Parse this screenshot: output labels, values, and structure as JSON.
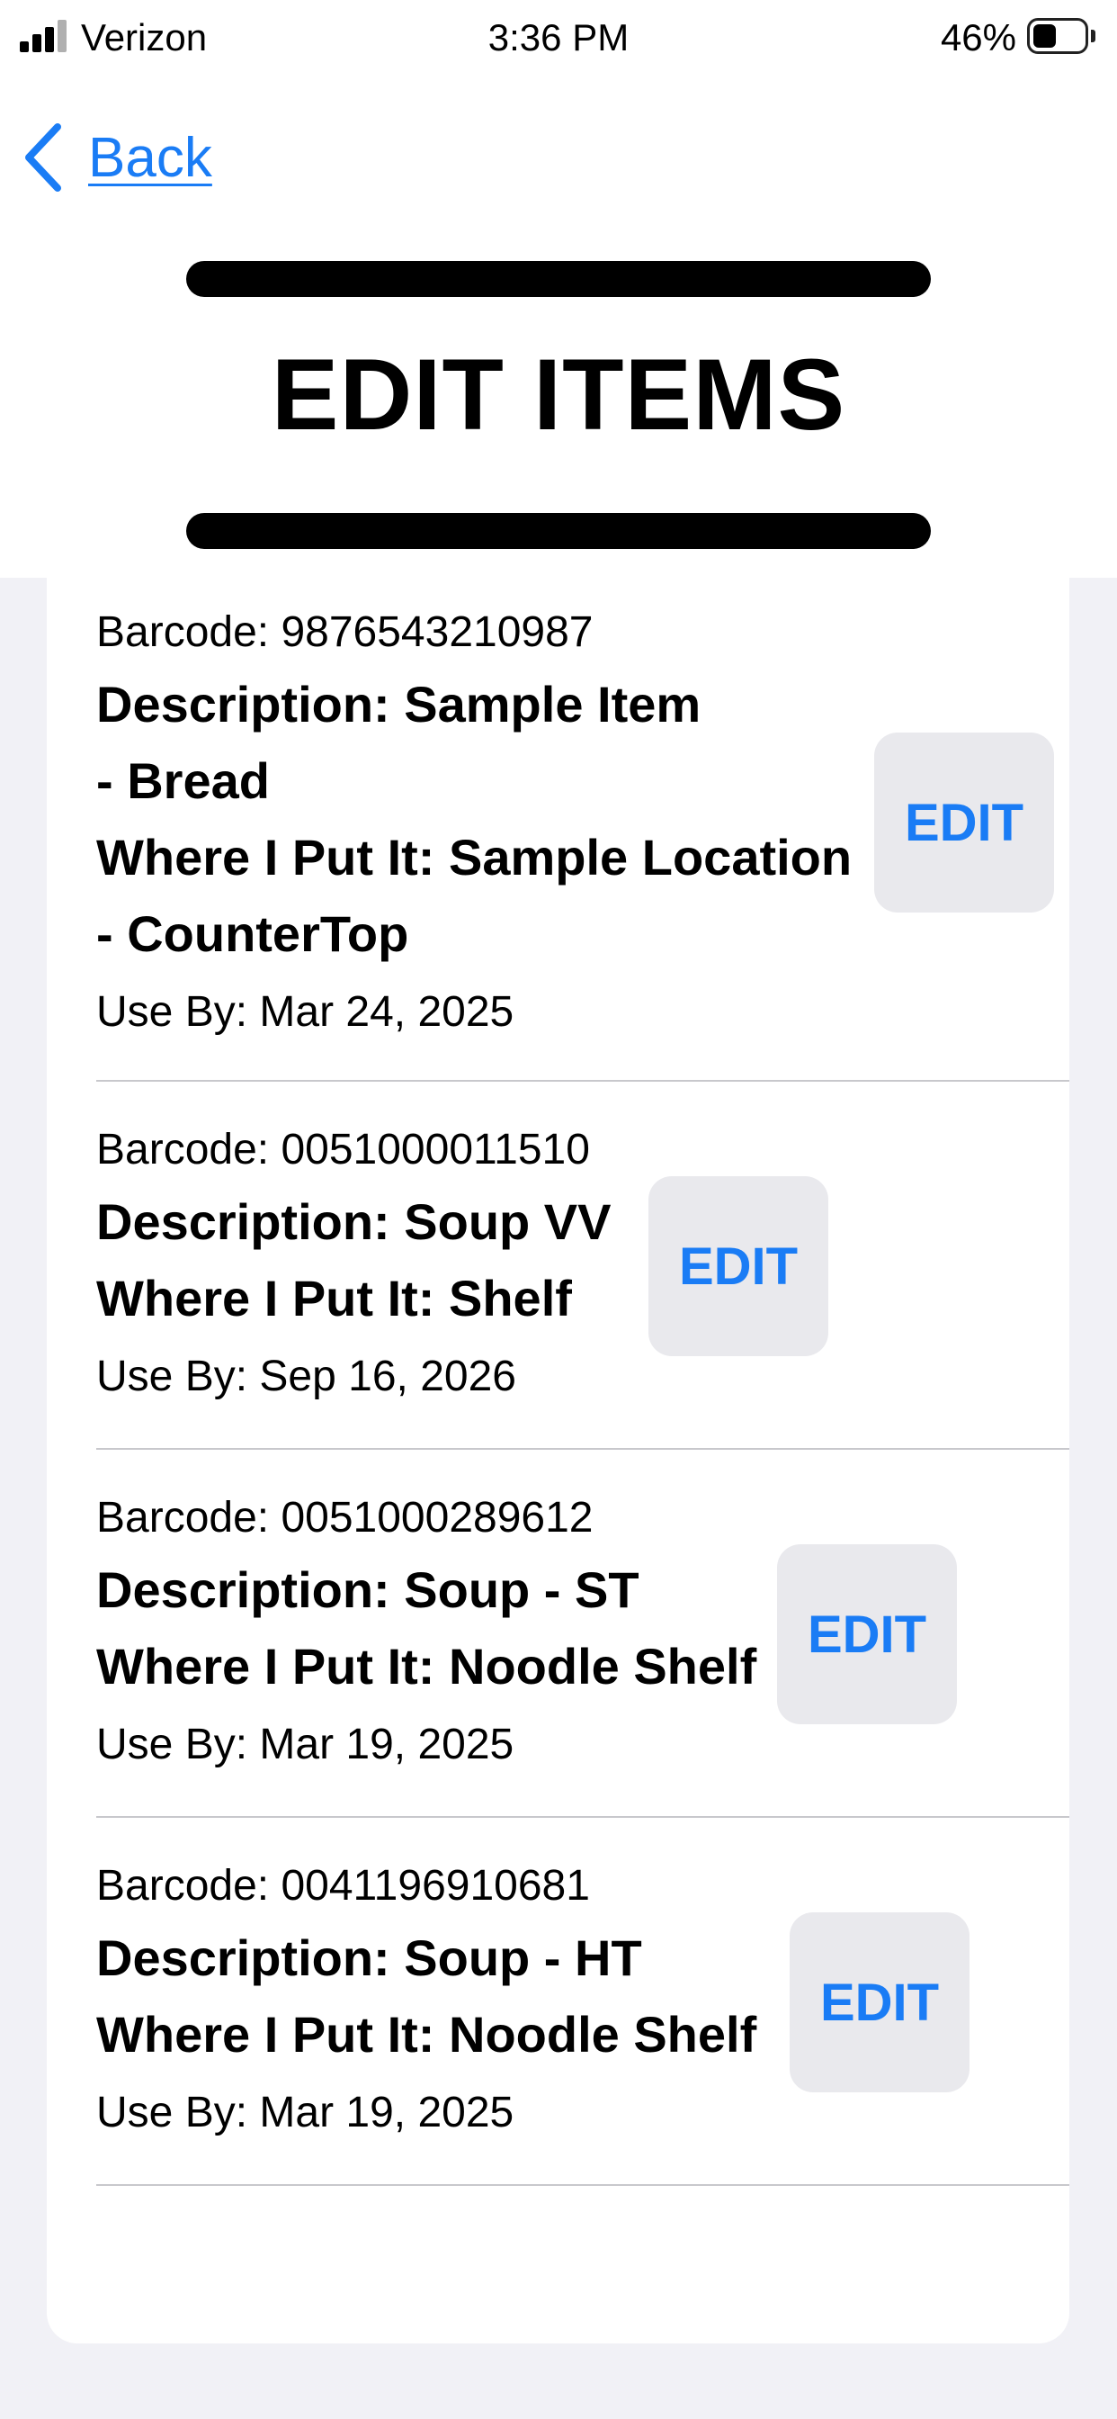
{
  "status_bar": {
    "carrier": "Verizon",
    "time": "3:36 PM",
    "battery_percent": "46%",
    "battery_level": 0.46
  },
  "nav": {
    "back_label": "Back"
  },
  "page": {
    "title": "EDIT ITEMS"
  },
  "colors": {
    "accent": "#1a7cf5",
    "button_bg": "#e9e9ed",
    "page_bg": "#f1f1f6"
  },
  "items": [
    {
      "barcode": "Barcode: 9876543210987",
      "description_line1": "Description: Sample Item",
      "description_line2": "- Bread",
      "location_line1": "Where I Put It: Sample Location",
      "location_line2": "- CounterTop",
      "use_by": "Use By: Mar 24, 2025",
      "edit_label": "EDIT"
    },
    {
      "barcode": "Barcode: 0051000011510",
      "description": "Description: Soup VV",
      "location": "Where I Put It: Shelf",
      "use_by": "Use By: Sep 16, 2026",
      "edit_label": "EDIT"
    },
    {
      "barcode": "Barcode: 0051000289612",
      "description": "Description: Soup - ST",
      "location": "Where I Put It: Noodle Shelf",
      "use_by": "Use By: Mar 19, 2025",
      "edit_label": "EDIT"
    },
    {
      "barcode": "Barcode: 0041196910681",
      "description": "Description: Soup - HT",
      "location": "Where I Put It: Noodle Shelf",
      "use_by": "Use By: Mar 19, 2025",
      "edit_label": "EDIT"
    }
  ]
}
